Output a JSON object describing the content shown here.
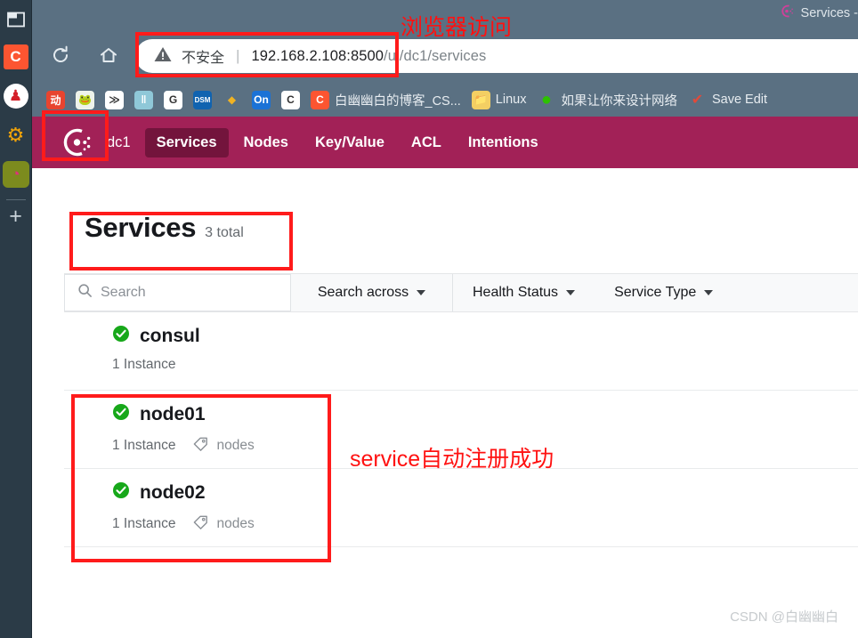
{
  "browser": {
    "tab_title": "Services -",
    "tab_favicon": "consul-favicon-icon",
    "nav": {
      "back_label": "←",
      "reload_label": "⟳",
      "home_label": "⌂"
    },
    "omnibox": {
      "security_label": "不安全",
      "separator": "|",
      "url_host": "192.168.2.108:8500",
      "url_path": "/ui/dc1/services"
    },
    "bookmarks": [
      {
        "label": "",
        "icon": "jd-app-icon",
        "color": "#e8442f",
        "glyph": "动"
      },
      {
        "label": "",
        "icon": "frog-app-icon",
        "color": "#eef3ea",
        "glyph": "🐸"
      },
      {
        "label": "",
        "icon": "teambition-icon",
        "color": "#ffffff",
        "glyph": "≫"
      },
      {
        "label": "",
        "icon": "waveform-icon",
        "color": "#8fc8d8",
        "glyph": "‖"
      },
      {
        "label": "",
        "icon": "g-circle-icon",
        "color": "#ffffff",
        "glyph": "G"
      },
      {
        "label": "",
        "icon": "dsm-synology-icon",
        "color": "#1063b0",
        "glyph": "DSM"
      },
      {
        "label": "",
        "icon": "yellow-cube-icon",
        "color": "#5a7082",
        "glyph": "◆"
      },
      {
        "label": "",
        "icon": "on-app-icon",
        "color": "#1b72d6",
        "glyph": "On"
      },
      {
        "label": "",
        "icon": "c-gradient-icon",
        "color": "#ffffff",
        "glyph": "C"
      },
      {
        "label": "白幽幽白的博客_CS...",
        "icon": "csdn-icon",
        "color": "#fc5531",
        "glyph": "C"
      },
      {
        "label": "Linux",
        "icon": "folder-icon",
        "color": "#f3cf63",
        "glyph": "📁"
      },
      {
        "label": "如果让你来设计网络",
        "icon": "wechat-icon",
        "color": "#2dc100",
        "glyph": "●"
      },
      {
        "label": "Save Edit",
        "icon": "save-edit-icon",
        "color": "#5a7082",
        "glyph": "✔"
      }
    ]
  },
  "sidebar": {
    "items": [
      {
        "name": "window-tile-icon",
        "glyph": "▣",
        "color": "#e3e8eb",
        "active": false
      },
      {
        "name": "csdn-icon",
        "glyph": "C",
        "color": "#fc5531",
        "active": false
      },
      {
        "name": "apache-feather-icon",
        "glyph": "♟",
        "color": "#d42029",
        "active": false
      },
      {
        "name": "gear-spiral-icon",
        "glyph": "⚙",
        "color": "#f0a30a",
        "active": false
      },
      {
        "name": "consul-app-icon",
        "glyph": "C",
        "color": "#e0307d",
        "active": true
      }
    ],
    "add_label": "+"
  },
  "consul": {
    "logo_name": "consul-logo-icon",
    "datacenter": "dc1",
    "tabs": [
      {
        "label": "Services",
        "active": true
      },
      {
        "label": "Nodes",
        "active": false
      },
      {
        "label": "Key/Value",
        "active": false
      },
      {
        "label": "ACL",
        "active": false
      },
      {
        "label": "Intentions",
        "active": false
      }
    ],
    "page_title": "Services",
    "page_total": "3 total",
    "filters": {
      "search_placeholder": "Search",
      "search_value": "",
      "search_across_label": "Search across",
      "health_status_label": "Health Status",
      "service_type_label": "Service Type"
    },
    "services": [
      {
        "name": "consul",
        "status": "passing",
        "instances": "1 Instance",
        "tag": ""
      },
      {
        "name": "node01",
        "status": "passing",
        "instances": "1 Instance",
        "tag": "nodes"
      },
      {
        "name": "node02",
        "status": "passing",
        "instances": "1 Instance",
        "tag": "nodes"
      }
    ]
  },
  "annotations": {
    "browser_access": "浏览器访问",
    "service_registered": "service自动注册成功",
    "watermark": "CSDN @白幽幽白"
  },
  "colors": {
    "chrome_bg": "#5a7082",
    "sidebar_bg": "#2b3b47",
    "consul_nav": "#a22157",
    "consul_nav_active": "#73143c",
    "annotation_red": "#ff1b1b",
    "status_green": "#17a81a"
  }
}
